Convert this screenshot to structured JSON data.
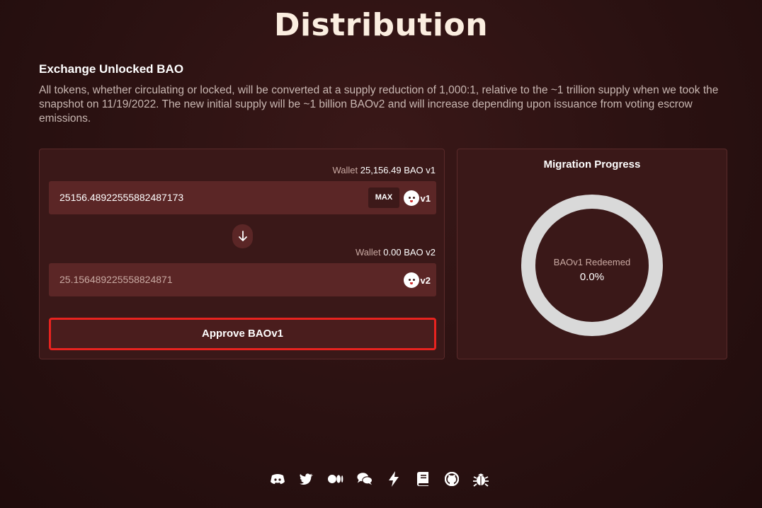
{
  "page": {
    "title": "Distribution"
  },
  "exchange": {
    "heading": "Exchange Unlocked BAO",
    "description": "All tokens, whether circulating or locked, will be converted at a supply reduction of 1,000:1, relative to the ~1 trillion supply when we took the snapshot on 11/19/2022. The new initial supply will be ~1 billion BAOv2 and will increase depending upon issuance from voting escrow emissions."
  },
  "swap": {
    "from": {
      "wallet_label": "Wallet",
      "wallet_value": "25,156.49 BAO v1",
      "amount": "25156.48922555882487173",
      "max_label": "MAX",
      "token_label": "v1",
      "token_icon": "bao-chef-icon"
    },
    "to": {
      "wallet_label": "Wallet",
      "wallet_value": "0.00 BAO v2",
      "amount": "25.156489225558824871",
      "token_label": "v2",
      "token_icon": "bao-chef-icon"
    },
    "arrow_icon": "arrow-down-icon",
    "approve_label": "Approve BAOv1"
  },
  "progress": {
    "title": "Migration Progress",
    "label": "BAOv1 Redeemed",
    "value": "0.0%",
    "fraction": 0.0
  },
  "social": {
    "icons": [
      "discord-icon",
      "twitter-icon",
      "medium-icon",
      "forum-icon",
      "snapshot-icon",
      "docs-icon",
      "github-icon",
      "bug-icon"
    ]
  },
  "colors": {
    "background": "#2a1111",
    "panel": "#3a1818",
    "input": "#5b2626",
    "highlight": "#e8231f",
    "ring": "#d9d9d9"
  }
}
